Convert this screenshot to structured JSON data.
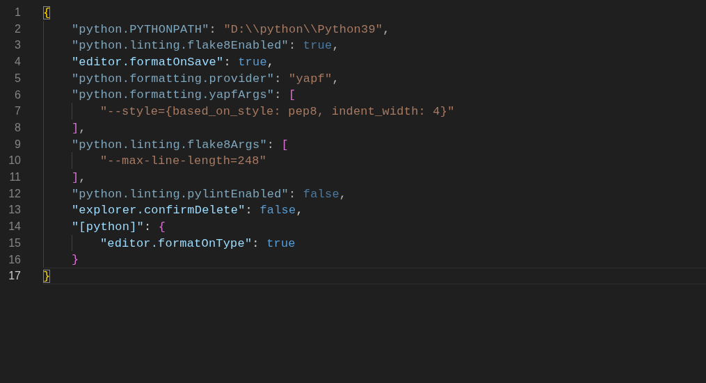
{
  "editor": {
    "lines": [
      {
        "number": "1",
        "current": false,
        "faded": false,
        "tokens": [
          {
            "text": "{",
            "kind": "bracket",
            "color": "#ffd700",
            "matched": true
          }
        ],
        "children": [
          {
            "number": "2",
            "current": false,
            "faded": true,
            "tokens": [
              {
                "text": "\"python.PYTHONPATH\"",
                "kind": "key"
              },
              {
                "text": ": ",
                "kind": "punct"
              },
              {
                "text": "\"D:\\\\python\\\\Python39\"",
                "kind": "string"
              },
              {
                "text": ",",
                "kind": "punct"
              }
            ]
          },
          {
            "number": "3",
            "current": false,
            "faded": true,
            "tokens": [
              {
                "text": "\"python.linting.flake8Enabled\"",
                "kind": "key"
              },
              {
                "text": ": ",
                "kind": "punct"
              },
              {
                "text": "true",
                "kind": "keyword"
              },
              {
                "text": ",",
                "kind": "punct"
              }
            ]
          },
          {
            "number": "4",
            "current": false,
            "faded": false,
            "tokens": [
              {
                "text": "\"editor.formatOnSave\"",
                "kind": "key"
              },
              {
                "text": ": ",
                "kind": "punct"
              },
              {
                "text": "true",
                "kind": "keyword"
              },
              {
                "text": ",",
                "kind": "punct"
              }
            ]
          },
          {
            "number": "5",
            "current": false,
            "faded": true,
            "tokens": [
              {
                "text": "\"python.formatting.provider\"",
                "kind": "key"
              },
              {
                "text": ": ",
                "kind": "punct"
              },
              {
                "text": "\"yapf\"",
                "kind": "string"
              },
              {
                "text": ",",
                "kind": "punct"
              }
            ]
          },
          {
            "number": "6",
            "current": false,
            "faded": true,
            "tokens": [
              {
                "text": "\"python.formatting.yapfArgs\"",
                "kind": "key"
              },
              {
                "text": ": ",
                "kind": "punct"
              },
              {
                "text": "[",
                "kind": "bracket",
                "color": "#da70d6",
                "matched": false
              }
            ],
            "children": [
              {
                "number": "7",
                "current": false,
                "faded": true,
                "tokens": [
                  {
                    "text": "\"--style={based_on_style: pep8, indent_width: 4}\"",
                    "kind": "string"
                  }
                ]
              }
            ]
          },
          {
            "number": "8",
            "current": false,
            "faded": true,
            "tokens": [
              {
                "text": "]",
                "kind": "bracket",
                "color": "#da70d6",
                "matched": false
              },
              {
                "text": ",",
                "kind": "punct"
              }
            ]
          },
          {
            "number": "9",
            "current": false,
            "faded": true,
            "tokens": [
              {
                "text": "\"python.linting.flake8Args\"",
                "kind": "key"
              },
              {
                "text": ": ",
                "kind": "punct"
              },
              {
                "text": "[",
                "kind": "bracket",
                "color": "#da70d6",
                "matched": false
              }
            ],
            "children": [
              {
                "number": "10",
                "current": false,
                "faded": true,
                "tokens": [
                  {
                    "text": "\"--max-line-length=248\"",
                    "kind": "string"
                  }
                ]
              }
            ]
          },
          {
            "number": "11",
            "current": false,
            "faded": true,
            "tokens": [
              {
                "text": "]",
                "kind": "bracket",
                "color": "#da70d6",
                "matched": false
              },
              {
                "text": ",",
                "kind": "punct"
              }
            ]
          },
          {
            "number": "12",
            "current": false,
            "faded": true,
            "tokens": [
              {
                "text": "\"python.linting.pylintEnabled\"",
                "kind": "key"
              },
              {
                "text": ": ",
                "kind": "punct"
              },
              {
                "text": "false",
                "kind": "keyword"
              },
              {
                "text": ",",
                "kind": "punct"
              }
            ]
          },
          {
            "number": "13",
            "current": false,
            "faded": false,
            "tokens": [
              {
                "text": "\"explorer.confirmDelete\"",
                "kind": "key"
              },
              {
                "text": ": ",
                "kind": "punct"
              },
              {
                "text": "false",
                "kind": "keyword"
              },
              {
                "text": ",",
                "kind": "punct"
              }
            ]
          },
          {
            "number": "14",
            "current": false,
            "faded": false,
            "tokens": [
              {
                "text": "\"[python]\"",
                "kind": "key"
              },
              {
                "text": ": ",
                "kind": "punct"
              },
              {
                "text": "{",
                "kind": "bracket",
                "color": "#da70d6",
                "matched": false
              }
            ],
            "children": [
              {
                "number": "15",
                "current": false,
                "faded": false,
                "tokens": [
                  {
                    "text": "\"editor.formatOnType\"",
                    "kind": "key"
                  },
                  {
                    "text": ": ",
                    "kind": "punct"
                  },
                  {
                    "text": "true",
                    "kind": "keyword"
                  }
                ]
              }
            ]
          },
          {
            "number": "16",
            "current": false,
            "faded": false,
            "tokens": [
              {
                "text": "}",
                "kind": "bracket",
                "color": "#da70d6",
                "matched": false
              }
            ]
          }
        ]
      },
      {
        "number": "17",
        "current": true,
        "faded": false,
        "tokens": [
          {
            "text": "}",
            "kind": "bracket",
            "color": "#ffd700",
            "matched": true
          }
        ]
      }
    ]
  }
}
